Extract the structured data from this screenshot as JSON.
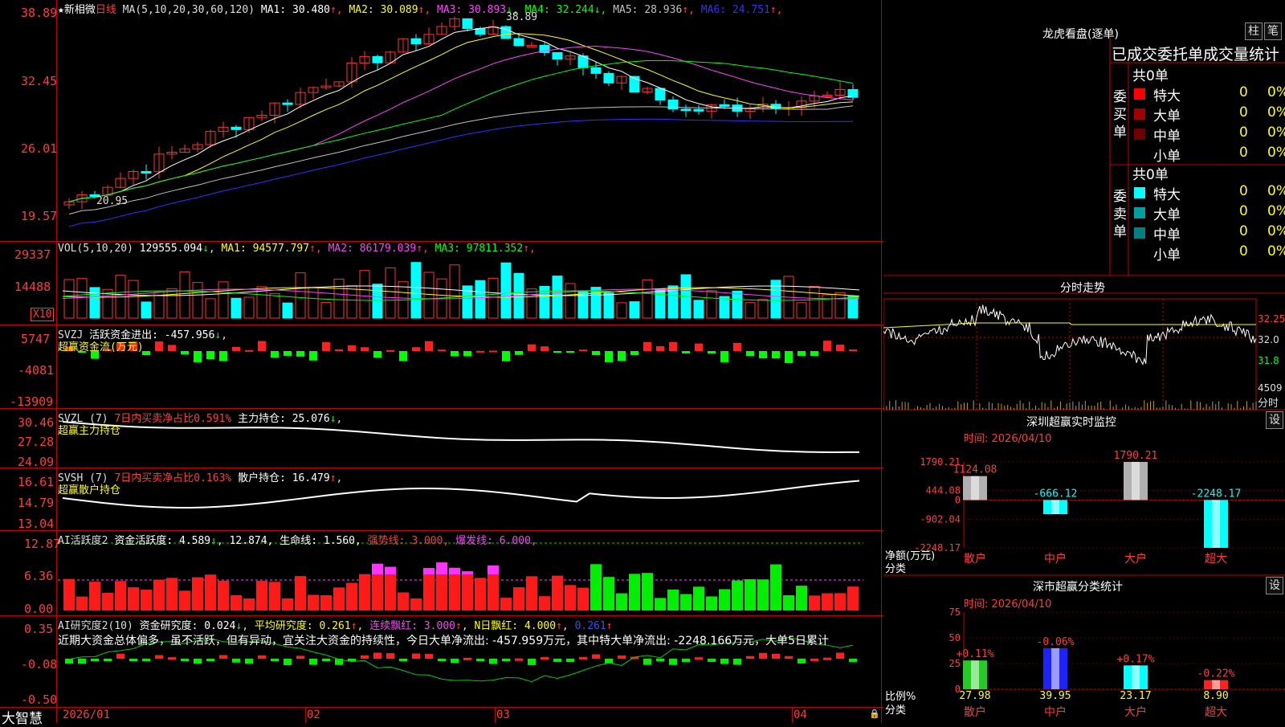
{
  "app": {
    "brand": "大智慧"
  },
  "main_chart": {
    "title_star": "★新相微",
    "period": "日线",
    "ma_label": "MA(5,10,20,30,60,120)",
    "ma": [
      {
        "name": "MA1",
        "value": "30.480",
        "arrow": "↑",
        "color": "#ffffff"
      },
      {
        "name": "MA2",
        "value": "30.089",
        "arrow": "↑",
        "color": "#ffff00"
      },
      {
        "name": "MA3",
        "value": "30.893",
        "arrow": "↓",
        "color": "#ff40ff"
      },
      {
        "name": "MA4",
        "value": "32.244",
        "arrow": "↓",
        "color": "#00ff00"
      },
      {
        "name": "MA5",
        "value": "28.936",
        "arrow": "↑",
        "color": "#c0c0c0"
      },
      {
        "name": "MA6",
        "value": "24.751",
        "arrow": "↑",
        "color": "#3030ff"
      }
    ],
    "y_labels": [
      "38.89",
      "32.45",
      "26.01",
      "19.57"
    ],
    "high_mark": "38.89",
    "low_mark": "20.95"
  },
  "vol_panel": {
    "label": "VOL(5,10,20)",
    "value": "129555.094",
    "arrow": "↓",
    "ma": [
      {
        "name": "MA1",
        "value": "94577.797",
        "arrow": "↑",
        "color": "#ffff00"
      },
      {
        "name": "MA2",
        "value": "86179.039",
        "arrow": "↑",
        "color": "#ff40ff"
      },
      {
        "name": "MA3",
        "value": "97811.352",
        "arrow": "↑",
        "color": "#00ff00"
      }
    ],
    "y_labels": [
      "29337",
      "14488"
    ],
    "unit": "X10"
  },
  "svzj_panel": {
    "label": "SVZJ",
    "text": "活跃资金进出: -457.956",
    "arrow": "↓",
    "sub": "超赢资金流(万元)",
    "y_labels": [
      "5747",
      "-4081",
      "-13909"
    ]
  },
  "svzl_panel": {
    "label": "SVZL (7)",
    "red_text": "7日内买卖净占比0.591%",
    "text": "主力持仓: 25.076",
    "arrow": "↓",
    "sub": "超赢主力持仓",
    "y_labels": [
      "30.46",
      "27.28",
      "24.09"
    ]
  },
  "svsh_panel": {
    "label": "SVSH (7)",
    "red_text": "7日内买卖净占比0.163%",
    "text": "散户持仓: 16.479",
    "arrow": "↑",
    "sub": "超赢散户持仓",
    "y_labels": [
      "16.61",
      "14.79",
      "13.04"
    ]
  },
  "ai_active": {
    "label": "AI活跃度2",
    "part1": "资金活跃度: 4.589",
    "arrow1": "↓",
    "part2": "12.874,",
    "part3": "生命线: 1.560,",
    "part4": "强势线: 3.000,",
    "part5": "爆发线: 6.000,",
    "y_labels": [
      "12.87",
      "6.36",
      "0.00"
    ]
  },
  "ai_research": {
    "label": "AI研究度2(10)",
    "part1": "资金研究度: 0.024",
    "arrow1": "↓",
    "part2": "平均研究度: 0.261",
    "arrow2": "↑",
    "part3": "连续飘红: 3.000",
    "arrow3": "↑",
    "part4": "N日飘红: 4.000",
    "arrow4": "↑",
    "part5": "0.261",
    "arrow5": "↑",
    "comment": "近期大资金总体偏多，虽不活跃，但有异动，宜关注大资金的持续性，今日大单净流出: -457.959万元，其中特大单净流出: -2248.166万元，大单5日累计",
    "y_labels": [
      "0.35",
      "-0.08",
      "-0.50"
    ]
  },
  "x_axis": {
    "labels": [
      "2026/01",
      "02",
      "03",
      "04"
    ]
  },
  "dragon_tiger": {
    "title": "龙虎看盘(逐单)",
    "btn1": "柱",
    "btn2": "笔",
    "subtitle": "已成交委托单成交量统计",
    "buy_side_label": "委买单",
    "sell_side_label": "委卖单",
    "buy_total": "共0单",
    "sell_total": "共0单",
    "buy_rows": [
      {
        "label": "特大",
        "count": "0",
        "pct": "0%",
        "color": "#ff0000"
      },
      {
        "label": "大单",
        "count": "0",
        "pct": "0%",
        "color": "#a00000"
      },
      {
        "label": "中单",
        "count": "0",
        "pct": "0%",
        "color": "#700000"
      },
      {
        "label": "小单",
        "count": "0",
        "pct": "0%",
        "color": ""
      }
    ],
    "sell_rows": [
      {
        "label": "特大",
        "count": "0",
        "pct": "0%",
        "color": "#00ffff"
      },
      {
        "label": "大单",
        "count": "0",
        "pct": "0%",
        "color": "#00a0a0"
      },
      {
        "label": "中单",
        "count": "0",
        "pct": "0%",
        "color": "#008080"
      },
      {
        "label": "小单",
        "count": "0",
        "pct": "0%",
        "color": ""
      }
    ]
  },
  "intraday": {
    "title": "分时走势",
    "right_labels": [
      "32.25",
      "32.0",
      "31.8"
    ],
    "vol_label": "4509",
    "btn": "分时"
  },
  "sz_monitor": {
    "title": "深圳超赢实时监控",
    "btn": "设",
    "time": "时间: 2026/04/10",
    "y_labels": [
      "1790.21",
      "444.08",
      "0",
      "-902.04",
      "-2248.17"
    ],
    "axis_name1": "净额(万元)",
    "axis_name2": "分类",
    "categories": [
      "散户",
      "中户",
      "大户",
      "超大"
    ],
    "values": [
      1124.08,
      -666.12,
      1790.21,
      -2248.17
    ],
    "value_labels": [
      "1124.08",
      "-666.12",
      "1790.21",
      "-2248.17"
    ]
  },
  "sz_class": {
    "title": "深市超赢分类统计",
    "btn": "设",
    "time": "时间: 2026/04/10",
    "y_labels": [
      "75",
      "50",
      "25",
      "0"
    ],
    "axis_name1": "比例%",
    "axis_name2": "分类",
    "categories": [
      "散户",
      "中户",
      "大户",
      "超大"
    ],
    "values": [
      27.98,
      39.95,
      23.17,
      8.9
    ],
    "value_labels": [
      "27.98",
      "39.95",
      "23.17",
      "8.90"
    ],
    "change_labels": [
      "+0.11%",
      "-0.06%",
      "+0.17%",
      "-0.22%"
    ]
  },
  "chart_data": [
    {
      "type": "bar",
      "title": "深圳超赢实时监控",
      "categories": [
        "散户",
        "中户",
        "大户",
        "超大"
      ],
      "values": [
        1124.08,
        -666.12,
        1790.21,
        -2248.17
      ],
      "ylabel": "净额(万元)",
      "ylim": [
        -2248.17,
        1790.21
      ]
    },
    {
      "type": "bar",
      "title": "深市超赢分类统计",
      "categories": [
        "散户",
        "中户",
        "大户",
        "超大"
      ],
      "values": [
        27.98,
        39.95,
        23.17,
        8.9
      ],
      "ylabel": "比例%",
      "ylim": [
        0,
        75
      ]
    }
  ]
}
